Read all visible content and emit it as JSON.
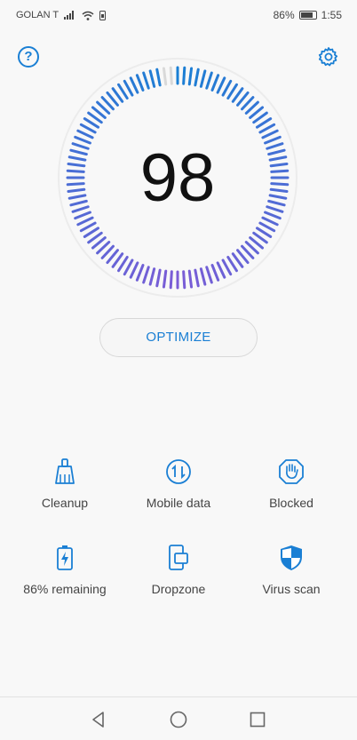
{
  "status_bar": {
    "carrier": "GOLAN T",
    "battery_percent": "86%",
    "time": "1:55"
  },
  "header": {
    "help_glyph": "?",
    "icons": [
      "help-icon",
      "settings-icon"
    ]
  },
  "gauge": {
    "score": "98",
    "score_fraction": 0.98
  },
  "optimize": {
    "label": "OPTIMIZE"
  },
  "tools": [
    {
      "label": "Cleanup",
      "icon": "broom-icon"
    },
    {
      "label": "Mobile data",
      "icon": "data-transfer-icon"
    },
    {
      "label": "Blocked",
      "icon": "blocked-hand-icon"
    },
    {
      "label": "86% remaining",
      "icon": "battery-icon"
    },
    {
      "label": "Dropzone",
      "icon": "dropzone-icon"
    },
    {
      "label": "Virus scan",
      "icon": "shield-icon"
    }
  ],
  "colors": {
    "accent": "#1a7fd4",
    "gauge_start": "#1a7fd4",
    "gauge_end": "#7b5cd6",
    "gauge_inactive": "#d9d9d9"
  },
  "nav": [
    "back-icon",
    "home-icon",
    "recents-icon"
  ]
}
